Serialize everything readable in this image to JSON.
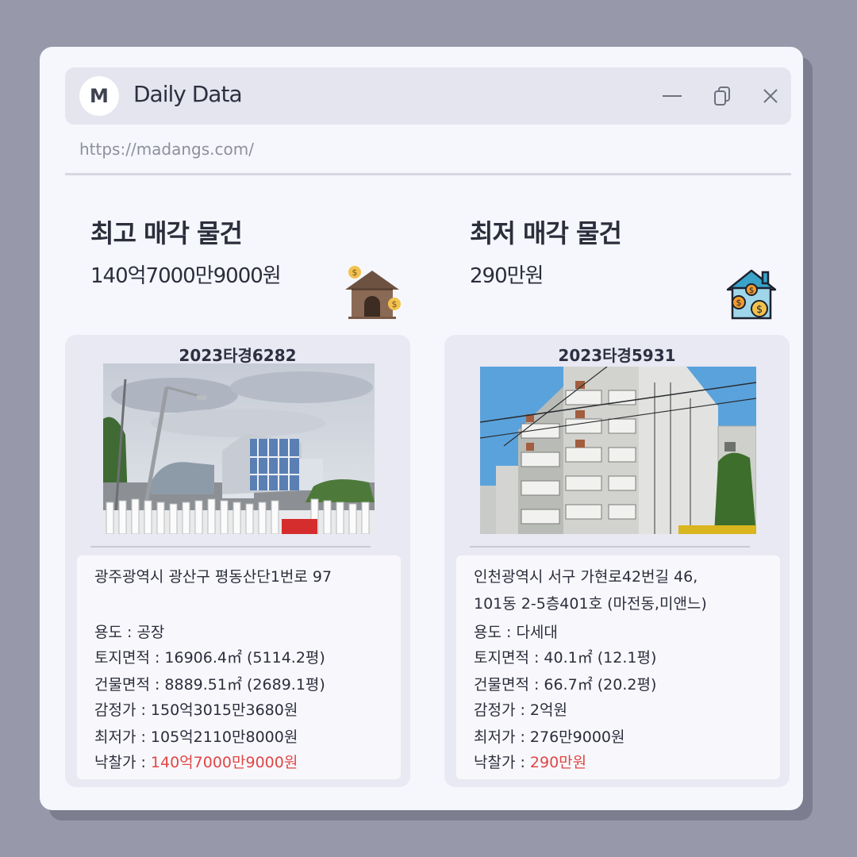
{
  "app": {
    "logo_letter": "M",
    "title": "Daily Data",
    "url": "https://madangs.com/"
  },
  "window_controls": [
    "minimize-icon",
    "restore-icon",
    "close-icon"
  ],
  "highest": {
    "heading": "최고 매각 물건",
    "price": "140억7000만9000원",
    "icon": "money-house-icon",
    "case_no": "2023타경6282",
    "address_line1": "광주광역시 광산구 평동산단1번로 97",
    "address_line2": "",
    "usage": "용도 : 공장",
    "land_area": "토지면적 : 16906.4㎡ (5114.2평)",
    "building_area": "건물면적 : 8889.51㎡ (2689.1평)",
    "appraisal": "감정가 : 150억3015만3680원",
    "minimum": "최저가 : 105억2110만8000원",
    "winning_label": "낙찰가 : ",
    "winning_price": "140억7000만9000원"
  },
  "lowest": {
    "heading": "최저 매각 물건",
    "price": "290만원",
    "icon": "house-coins-icon",
    "case_no": "2023타경5931",
    "address_line1": "인천광역시 서구 가현로42번길 46,",
    "address_line2": "101동 2-5층401호 (마전동,미앤느)",
    "usage": "용도 :  다세대",
    "land_area": "토지면적 : 40.1㎡ (12.1평)",
    "building_area": "건물면적 : 66.7㎡ (20.2평)",
    "appraisal": "감정가 : 2억원",
    "minimum": "최저가 : 276만9000원",
    "winning_label": "낙찰가 : ",
    "winning_price": "290만원"
  },
  "colors": {
    "background": "#9799ab",
    "window": "#f6f7fc",
    "titlebar": "#e4e5ee",
    "card": "#e8e9f2",
    "winning_price": "#e04646"
  }
}
